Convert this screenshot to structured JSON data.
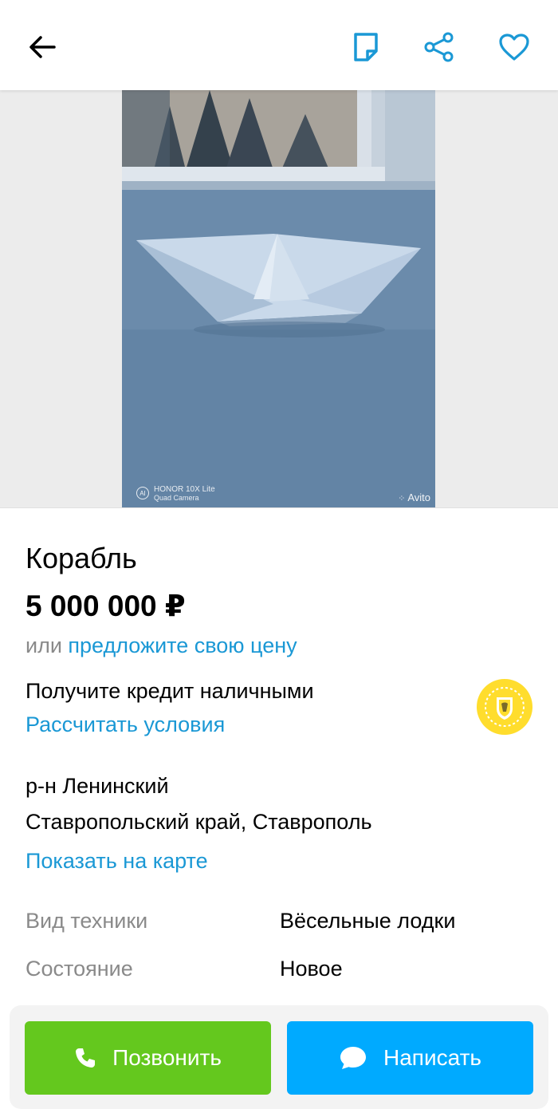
{
  "header": {
    "back_icon": "arrow-left-icon",
    "note_icon": "note-icon",
    "share_icon": "share-icon",
    "favorite_icon": "heart-icon",
    "accent_color": "#1a98d5"
  },
  "photo": {
    "camera_brand_line1": "HONOR 10X Lite",
    "camera_brand_line2": "Quad Camera",
    "ai_badge": "AI",
    "watermark": "Avito"
  },
  "listing": {
    "title": "Корабль",
    "price": "5 000 000 ₽",
    "offer_prefix": "или ",
    "offer_link": "предложите свою цену",
    "credit_text": "Получите кредит наличными",
    "credit_link": "Рассчитать условия",
    "district": "р-н Ленинский",
    "city": "Ставропольский край, Ставрополь",
    "map_link": "Показать на карте"
  },
  "properties": [
    {
      "label": "Вид техники",
      "value": "Вёсельные лодки"
    },
    {
      "label": "Состояние",
      "value": "Новое"
    }
  ],
  "actions": {
    "call_label": "Позвонить",
    "call_color": "#64c81e",
    "message_label": "Написать",
    "message_color": "#00aaff"
  }
}
